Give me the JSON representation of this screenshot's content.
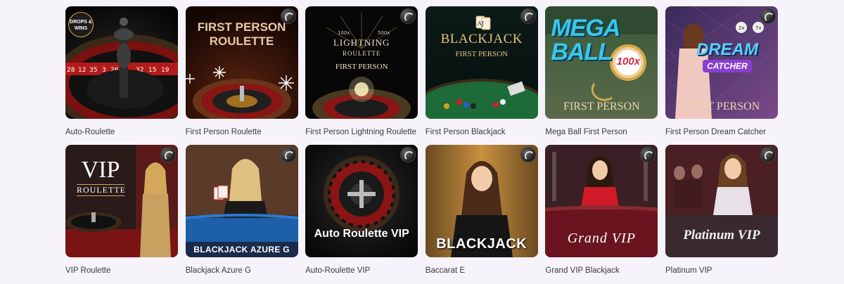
{
  "games": [
    {
      "name": "Auto-Roulette",
      "thumb": {
        "badge": "DROPS & WINS",
        "icon": "roulette-wheel-icon"
      }
    },
    {
      "name": "First Person Roulette",
      "thumb": {
        "line1": "FIRST PERSON",
        "line2": "ROULETTE",
        "icon": "snowflake-icon"
      }
    },
    {
      "name": "First Person Lightning Roulette",
      "thumb": {
        "line1": "LIGHTNING",
        "line2": "ROULETTE",
        "line3": "FIRST PERSON",
        "mult_left": "100x",
        "mult_right": "500x"
      }
    },
    {
      "name": "First Person Blackjack",
      "thumb": {
        "line1": "BLACKJACK",
        "line2": "FIRST PERSON",
        "cards": "AJ"
      }
    },
    {
      "name": "Mega Ball First Person",
      "thumb": {
        "line1": "MEGA",
        "line2": "BALL",
        "mult": "100x",
        "line3": "FIRST PERSON"
      }
    },
    {
      "name": "First Person Dream Catcher",
      "thumb": {
        "line1": "DREAM",
        "line2": "CATCHER",
        "line3": "FIRST PERSON",
        "chip_left": "2x",
        "chip_right": "7x"
      }
    },
    {
      "name": "VIP Roulette",
      "thumb": {
        "line1": "VIP",
        "line2": "ROULETTE"
      }
    },
    {
      "name": "Blackjack Azure G",
      "thumb": {
        "line1": "BLACKJACK AZURE G"
      }
    },
    {
      "name": "Auto-Roulette VIP",
      "thumb": {
        "line1": "Auto Roulette VIP"
      }
    },
    {
      "name": "Baccarat E",
      "thumb": {
        "line1": "BLACKJACK"
      }
    },
    {
      "name": "Grand VIP Blackjack",
      "thumb": {
        "line1": "Grand VIP"
      }
    },
    {
      "name": "Platinum VIP",
      "thumb": {
        "line1": "Platinum VIP"
      }
    }
  ],
  "colors": {
    "background": "#f7f3fa",
    "label": "#3a3a3a",
    "accent_gold": "#d4a84a",
    "accent_purple": "#8a3fd0"
  }
}
